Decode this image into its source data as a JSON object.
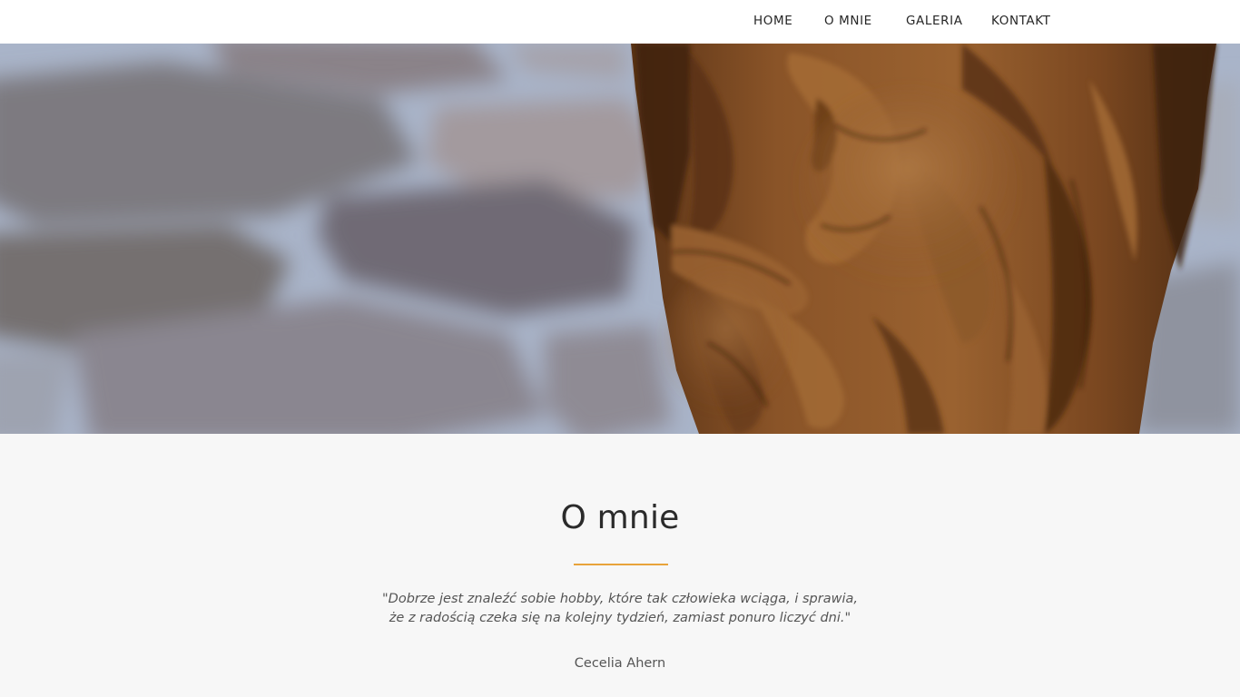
{
  "nav": {
    "items": [
      {
        "label": "HOME"
      },
      {
        "label": "O MNIE"
      },
      {
        "label": "GALERIA"
      },
      {
        "label": "KONTAKT"
      }
    ]
  },
  "hero": {
    "image": "wood-carving-photo"
  },
  "about": {
    "title": "O mnie",
    "quote_line1": "\"Dobrze jest znaleźć sobie hobby, które tak człowieka wciąga, i sprawia,",
    "quote_line2": "że z radością czeka się na kolejny tydzień, zamiast ponuro liczyć dni.\"",
    "author": "Cecelia Ahern"
  },
  "colors": {
    "accent": "#e8a33a",
    "background": "#f7f7f7",
    "nav_text": "#262626",
    "body_text": "#555555"
  }
}
